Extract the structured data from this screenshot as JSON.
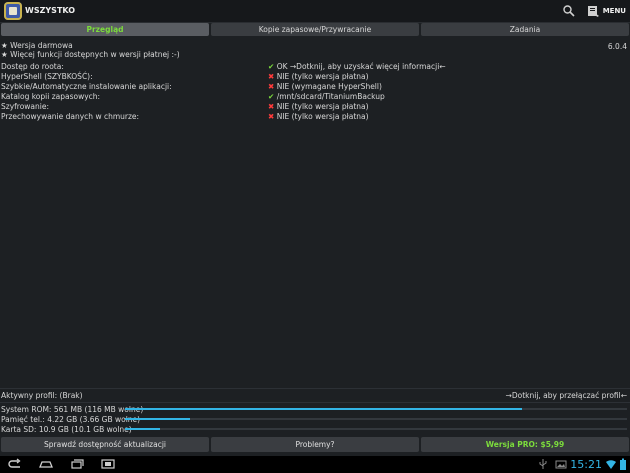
{
  "app": {
    "title": "WSZYSTKO",
    "menu_label": "MENU"
  },
  "tabs": [
    {
      "label": "Przegląd",
      "active": true
    },
    {
      "label": "Kopie zapasowe/Przywracanie",
      "active": false
    },
    {
      "label": "Zadania",
      "active": false
    }
  ],
  "info": {
    "line1": "★ Wersja darmowa",
    "line2": "★ Więcej funkcji dostępnych w wersji płatnej :-)",
    "version": "6.0.4"
  },
  "status_rows": [
    {
      "label": "Dostęp do roota:",
      "icon": "check",
      "value": "OK  →Dotknij, aby uzyskać więcej informacji←"
    },
    {
      "label": "HyperShell (SZYBKOŚĆ):",
      "icon": "cross",
      "value": "NIE (tylko wersja płatna)"
    },
    {
      "label": "Szybkie/Automatyczne instalowanie aplikacji:",
      "icon": "cross",
      "value": "NIE (wymagane HyperShell)"
    },
    {
      "label": "Katalog kopii zapasowych:",
      "icon": "check",
      "value": "/mnt/sdcard/TitaniumBackup"
    },
    {
      "label": "Szyfrowanie:",
      "icon": "cross",
      "value": "NIE (tylko wersja płatna)"
    },
    {
      "label": "Przechowywanie danych w chmurze:",
      "icon": "cross",
      "value": "NIE (tylko wersja płatna)"
    }
  ],
  "profile": {
    "label": "Aktywny profil:  (Brak)",
    "hint": "→Dotknij, aby przełączać profil←"
  },
  "storage": [
    {
      "label": "System ROM: 561 MB (116 MB wolne)",
      "used_fraction": 0.79
    },
    {
      "label": "Pamięć tel.:   4.22 GB (3.66 GB wolne)",
      "used_fraction": 0.13
    },
    {
      "label": "Karta SD:      10.9 GB (10.1 GB wolne)",
      "used_fraction": 0.07
    }
  ],
  "buttons": {
    "check_updates": "Sprawdź dostępność aktualizacji",
    "problems": "Problemy?",
    "pro": "Wersja PRO: $5,99"
  },
  "statusbar": {
    "time": "15:21"
  },
  "colors": {
    "accent_green": "#7cdc3c",
    "accent_blue": "#33b5e5",
    "error_red": "#ff3b3b"
  }
}
